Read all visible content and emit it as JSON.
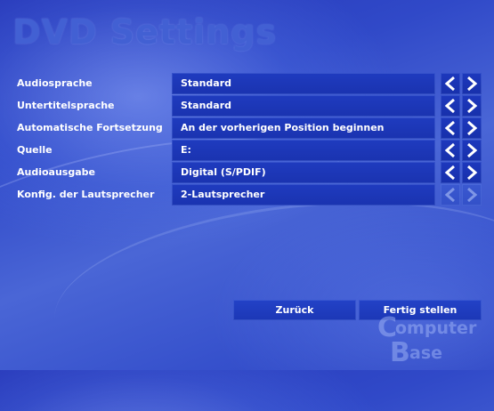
{
  "title": "DVD Settings",
  "settings": [
    {
      "label": "Audiosprache",
      "value": "Standard",
      "arrows_enabled": true
    },
    {
      "label": "Untertitelsprache",
      "value": "Standard",
      "arrows_enabled": true
    },
    {
      "label": "Automatische Fortsetzung",
      "value": "An der vorherigen Position beginnen",
      "arrows_enabled": true
    },
    {
      "label": "Quelle",
      "value": "E:",
      "arrows_enabled": true
    },
    {
      "label": "Audioausgabe",
      "value": "Digital (S/PDIF)",
      "arrows_enabled": true
    },
    {
      "label": "Konfig. der Lautsprecher",
      "value": "2-Lautsprecher",
      "arrows_enabled": false
    }
  ],
  "buttons": {
    "back": "Zurück",
    "finish": "Fertig stellen"
  },
  "watermark": {
    "line1": "Computer",
    "line2": "Base"
  },
  "colors": {
    "background": "#3049c8",
    "field": "#1f3bbf",
    "title": "#4260d3",
    "text": "#ffffff"
  },
  "icons": {
    "prev": "chevron-left-icon",
    "next": "chevron-right-icon"
  }
}
